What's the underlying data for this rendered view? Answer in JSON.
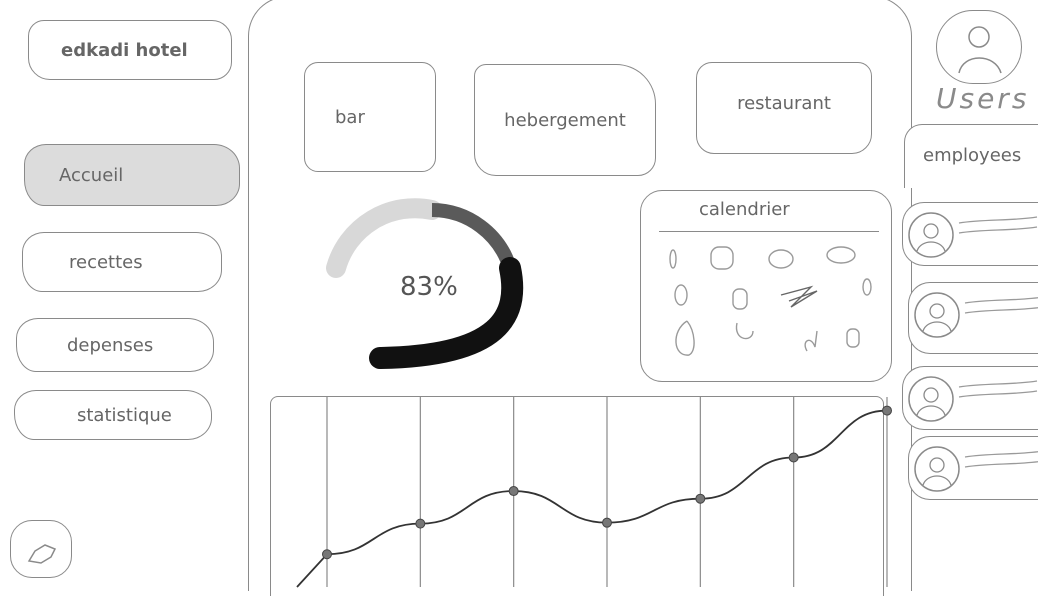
{
  "app": {
    "title": "edkadi hotel"
  },
  "sidebar": {
    "items": [
      {
        "label": "Accueil",
        "active": true
      },
      {
        "label": "recettes"
      },
      {
        "label": "depenses"
      },
      {
        "label": "statistique"
      }
    ],
    "logout_icon": "exit-icon"
  },
  "categories": [
    {
      "label": "bar"
    },
    {
      "label": "hebergement"
    },
    {
      "label": "restaurant"
    }
  ],
  "gauge": {
    "percent_text": "83%",
    "value": 0.83
  },
  "calendar": {
    "title": "calendrier"
  },
  "users": {
    "label": "Users",
    "icon": "user-icon"
  },
  "employees": {
    "label": "employees",
    "count": 4
  },
  "chart_data": {
    "type": "line",
    "title": "",
    "xlabel": "",
    "ylabel": "",
    "x": [
      1,
      2,
      3,
      4,
      5,
      6,
      7
    ],
    "series": [
      {
        "values": [
          30,
          62,
          96,
          63,
          88,
          131,
          180
        ]
      }
    ],
    "ylim": [
      0,
      190
    ],
    "grid": true
  },
  "colors": {
    "stroke": "#8a8a8a",
    "active_bg": "#dcdcdc",
    "gauge_light": "#d8d8d8",
    "gauge_mid": "#5a5a5a",
    "gauge_dark": "#111111"
  }
}
